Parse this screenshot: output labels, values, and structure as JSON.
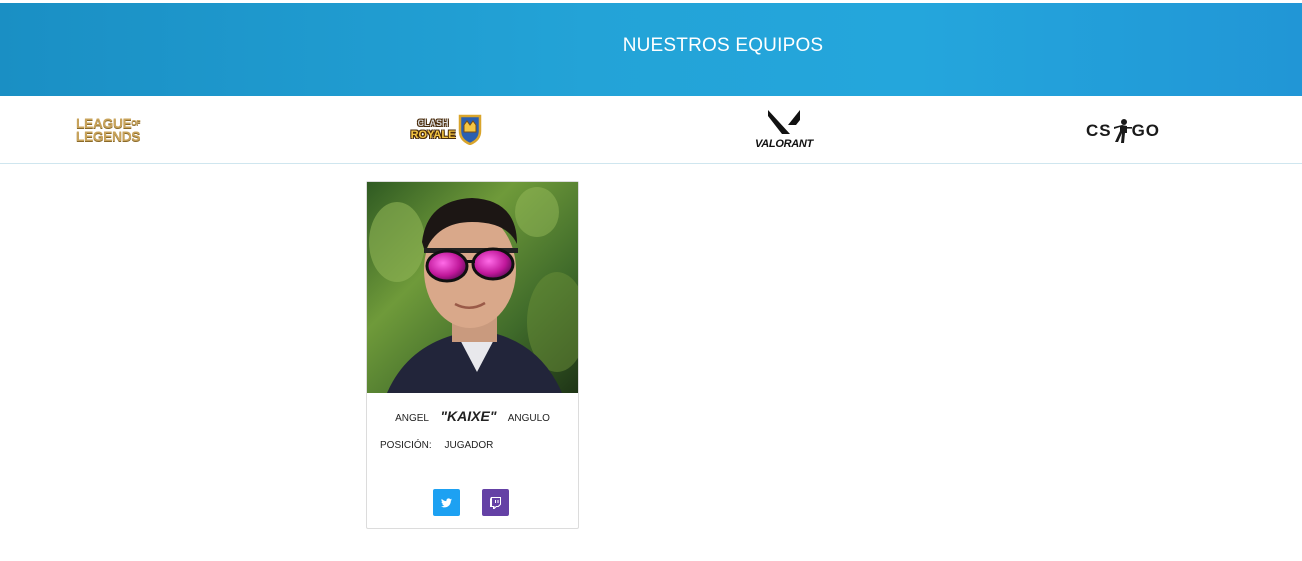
{
  "header": {
    "title": "NUESTROS EQUIPOS",
    "accent": "#23a3d7"
  },
  "games": [
    {
      "name": "League of Legends",
      "logo_line1": "LEAGUE",
      "logo_of": "OF",
      "logo_line2": "LEGENDS"
    },
    {
      "name": "Clash Royale",
      "logo_line1": "CLASH",
      "logo_line2": "ROYALE"
    },
    {
      "name": "Valorant",
      "logo_text": "VALORANT"
    },
    {
      "name": "CS:GO",
      "logo_left": "CS",
      "logo_right": "GO"
    }
  ],
  "player": {
    "first_name": "ANGEL",
    "nickname": "\"KAIXE\"",
    "last_name": "ANGULO",
    "position_label": "POSICIÓN:",
    "position_value": "JUGADOR",
    "socials": [
      {
        "icon": "twitter-icon",
        "color": "#1da1f2"
      },
      {
        "icon": "twitch-icon",
        "color": "#6441a5"
      }
    ]
  }
}
